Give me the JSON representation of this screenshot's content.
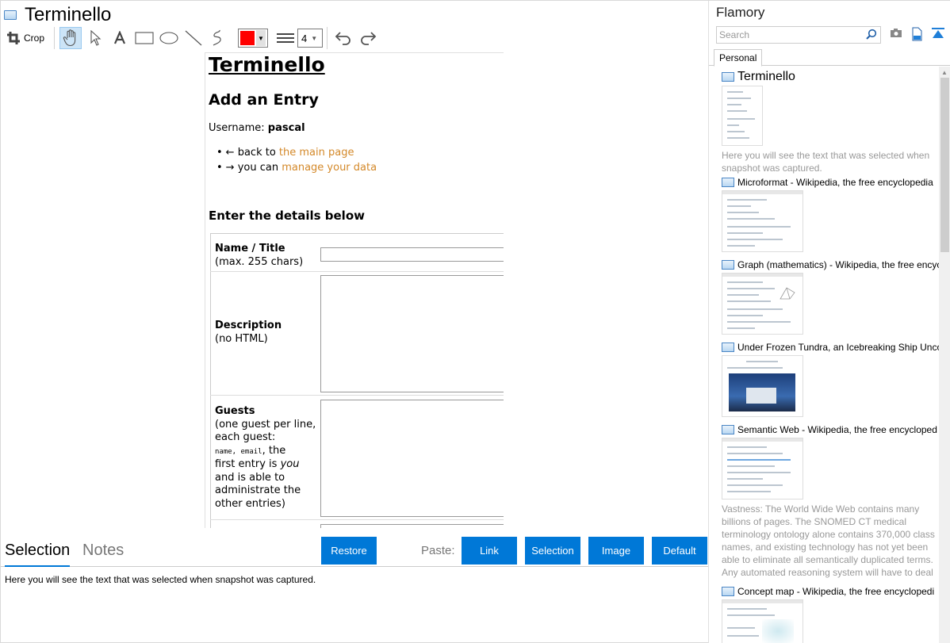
{
  "window": {
    "title": "Terminello"
  },
  "toolbar": {
    "crop_label": "Crop",
    "tools": [
      "hand-icon",
      "pointer-icon",
      "text-icon",
      "rectangle-icon",
      "ellipse-icon",
      "line-icon",
      "freehand-icon"
    ],
    "active_tool": "hand-icon",
    "color": "#ff0000",
    "line_width": "4"
  },
  "snapshot": {
    "title": "Terminello",
    "heading": "Add an Entry",
    "username_label": "Username:",
    "username": "pascal",
    "links": [
      {
        "prefix": "← back to ",
        "link": "the main page"
      },
      {
        "prefix": "→ you can ",
        "link": "manage your data"
      }
    ],
    "details_heading": "Enter the details below",
    "fields": [
      {
        "name": "Name / Title",
        "hint": "(max. 255 chars)"
      },
      {
        "name": "Description",
        "hint": "(no HTML)"
      },
      {
        "name": "Guests",
        "hint_lines": [
          "(one guest per line,",
          "each guest:"
        ],
        "code": "name, email",
        "after_code": ", the",
        "line4_pre": "first entry is ",
        "line4_em": "you",
        "rest": [
          "and is able to",
          "administrate the",
          "other entries)"
        ]
      }
    ]
  },
  "bottom": {
    "tabs": [
      "Selection",
      "Notes"
    ],
    "restore_label": "Restore",
    "paste_label": "Paste:",
    "paste_buttons": [
      "Link",
      "Selection",
      "Image",
      "Default"
    ],
    "selection_text": "Here you will see the text that was selected when snapshot was captured."
  },
  "sidebar": {
    "title": "Flamory",
    "search_placeholder": "Search",
    "tab": "Personal",
    "entries": [
      {
        "title": "Terminello",
        "note": "Here you will see the text that was selected when snapshot was captured."
      },
      {
        "title": "Microformat - Wikipedia, the free encyclopedia",
        "note": ""
      },
      {
        "title": "Graph (mathematics) - Wikipedia, the free encyc",
        "note": ""
      },
      {
        "title": "Under Frozen Tundra, an Icebreaking Ship Unco",
        "note": ""
      },
      {
        "title": "Semantic Web - Wikipedia, the free encycloped",
        "note": "Vastness: The World Wide Web contains many billions of pages. The SNOMED CT medical terminology ontology alone contains 370,000 class names, and existing technology has not yet been able to eliminate all semantically duplicated terms. Any automated reasoning system will have to deal with truly huge inputs."
      },
      {
        "title": "Concept map - Wikipedia, the free encyclopedi",
        "note": ""
      }
    ]
  }
}
